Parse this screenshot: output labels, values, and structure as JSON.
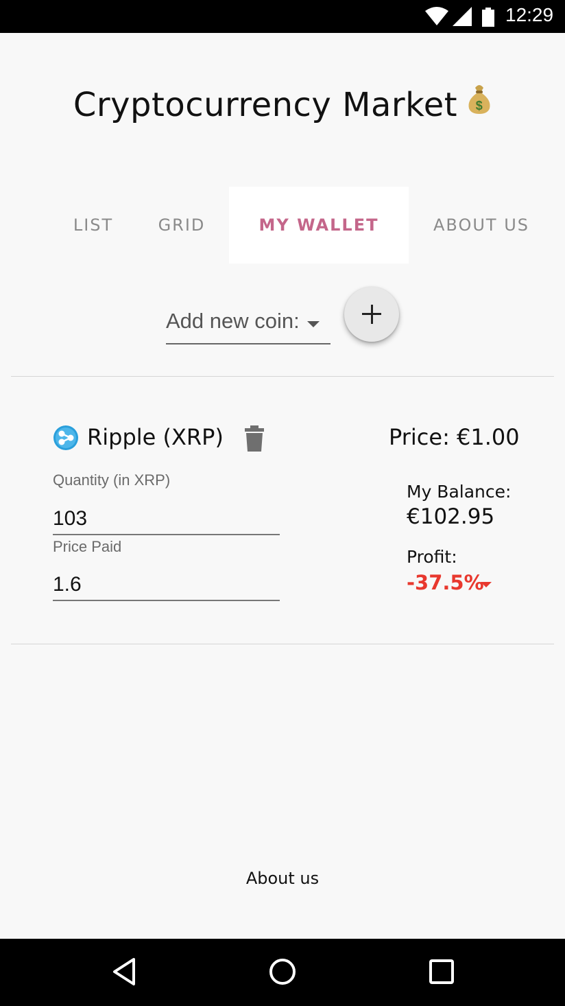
{
  "status_bar": {
    "time": "12:29"
  },
  "app": {
    "title": "Cryptocurrency Market",
    "title_icon": "money-bag-icon"
  },
  "tabs": [
    {
      "label": "LIST",
      "active": false
    },
    {
      "label": "GRID",
      "active": false
    },
    {
      "label": "MY WALLET",
      "active": true
    },
    {
      "label": "ABOUT US",
      "active": false
    }
  ],
  "add_coin": {
    "placeholder": "Add new coin:",
    "button_icon": "plus-icon"
  },
  "wallet": {
    "coin": {
      "name": "Ripple (XRP)",
      "icon": "ripple-icon",
      "price": "Price: €1.00",
      "quantity_label": "Quantity (in XRP)",
      "quantity_value": "103",
      "price_paid_label": "Price Paid",
      "price_paid_value": "1.6",
      "balance_label": "My Balance:",
      "balance_value": "€102.95",
      "profit_label": "Profit:",
      "profit_value": "-37.5%",
      "profit_trend": "down"
    }
  },
  "footer": {
    "link": "About us"
  },
  "colors": {
    "accent": "#c4668a",
    "tab_inactive": "#8a8a8a",
    "loss": "#e8382e",
    "ripple": "#2a9fdb",
    "background": "#f8f8f8"
  }
}
